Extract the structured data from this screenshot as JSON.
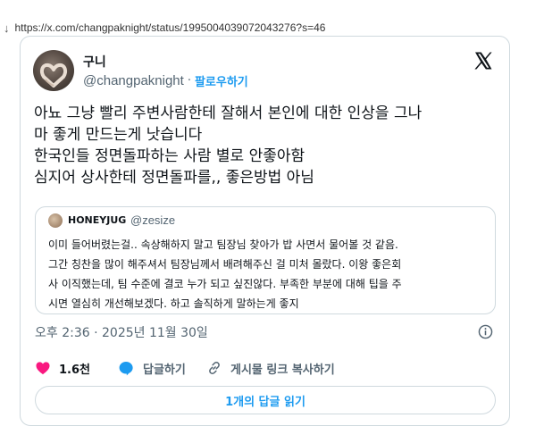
{
  "page": {
    "arrow_symbol": "↓",
    "url": "https://x.com/changpaknight/status/1995004039072043276?s=46"
  },
  "author": {
    "display_name": "구니",
    "handle": "@changpaknight",
    "separator": "·",
    "follow_label": "팔로우하기"
  },
  "tweet": {
    "lines": [
      "아뇨 그냥 빨리 주변사람한테 잘해서 본인에 대한 인상을 그나",
      "마 좋게 만드는게 낫습니다",
      "한국인들 정면돌파하는 사람 별로 안좋아함",
      "심지어 상사한테 정면돌파를,, 좋은방법 아님"
    ],
    "timestamp": "오후 2:36 · 2025년 11월 30일"
  },
  "quote": {
    "display_name": "HONEYJUG",
    "handle": "@zesize",
    "lines": [
      "이미 들어버렸는걸.. 속상해하지 말고 팀장님 찾아가 밥 사면서 물어볼 것 같음.",
      "그간 칭찬을 많이 해주셔서 팀장님께서 배려해주신 걸 미처 몰랐다. 이왕 좋은회",
      "사 이직했는데, 팀 수준에 결코 누가 되고 싶진않다. 부족한 부분에 대해 팁을 주",
      "시면 열심히 개선해보겠다. 하고 솔직하게 말하는게 좋지"
    ]
  },
  "actions": {
    "like_count": "1.6천",
    "reply_label": "답글하기",
    "share_label": "게시물 링크 복사하기"
  },
  "read_replies_label": "1개의 답글 읽기",
  "icons": {
    "arrow": "download-arrow-icon",
    "logo": "x-logo-icon",
    "info": "info-icon",
    "like": "heart-icon",
    "reply": "speech-bubble-icon",
    "share": "link-icon"
  },
  "colors": {
    "link_blue": "#1d9bf0",
    "like_pink": "#f91880",
    "muted_text": "#536471",
    "border": "#cfd9de",
    "text": "#0f1419"
  }
}
